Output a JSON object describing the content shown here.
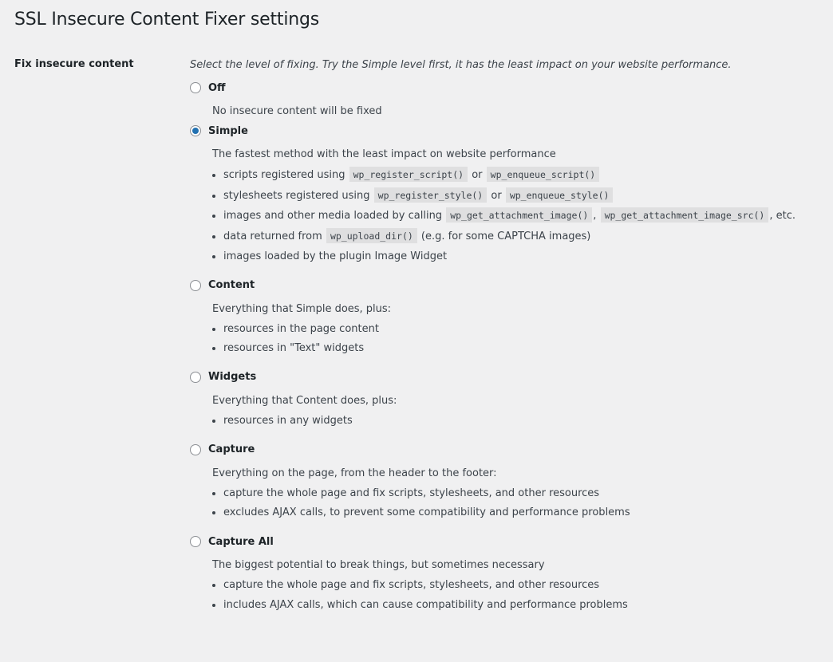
{
  "page": {
    "title": "SSL Insecure Content Fixer settings"
  },
  "setting": {
    "label": "Fix insecure content",
    "intro": "Select the level of fixing. Try the Simple level first, it has the least impact on your website performance.",
    "selected": "Simple",
    "options": [
      {
        "label": "Off",
        "checked": false,
        "description": "No insecure content will be fixed"
      },
      {
        "label": "Simple",
        "checked": true,
        "description": "The fastest method with the least impact on website performance",
        "bullets": [
          {
            "parts": [
              {
                "t": "scripts registered using "
              },
              {
                "c": "wp_register_script()"
              },
              {
                "t": " or "
              },
              {
                "c": "wp_enqueue_script()"
              }
            ]
          },
          {
            "parts": [
              {
                "t": "stylesheets registered using "
              },
              {
                "c": "wp_register_style()"
              },
              {
                "t": " or "
              },
              {
                "c": "wp_enqueue_style()"
              }
            ]
          },
          {
            "parts": [
              {
                "t": "images and other media loaded by calling "
              },
              {
                "c": "wp_get_attachment_image()"
              },
              {
                "t": ", "
              },
              {
                "c": "wp_get_attachment_image_src()"
              },
              {
                "t": ", etc."
              }
            ]
          },
          {
            "parts": [
              {
                "t": "data returned from "
              },
              {
                "c": "wp_upload_dir()"
              },
              {
                "t": " (e.g. for some CAPTCHA images)"
              }
            ]
          },
          {
            "parts": [
              {
                "t": "images loaded by the plugin Image Widget"
              }
            ]
          }
        ]
      },
      {
        "label": "Content",
        "checked": false,
        "description": "Everything that Simple does, plus:",
        "bullets": [
          {
            "parts": [
              {
                "t": "resources in the page content"
              }
            ]
          },
          {
            "parts": [
              {
                "t": "resources in \"Text\" widgets"
              }
            ]
          }
        ]
      },
      {
        "label": "Widgets",
        "checked": false,
        "description": "Everything that Content does, plus:",
        "bullets": [
          {
            "parts": [
              {
                "t": "resources in any widgets"
              }
            ]
          }
        ]
      },
      {
        "label": "Capture",
        "checked": false,
        "description": "Everything on the page, from the header to the footer:",
        "bullets": [
          {
            "parts": [
              {
                "t": "capture the whole page and fix scripts, stylesheets, and other resources"
              }
            ]
          },
          {
            "parts": [
              {
                "t": "excludes AJAX calls, to prevent some compatibility and performance problems"
              }
            ]
          }
        ]
      },
      {
        "label": "Capture All",
        "checked": false,
        "description": "The biggest potential to break things, but sometimes necessary",
        "bullets": [
          {
            "parts": [
              {
                "t": "capture the whole page and fix scripts, stylesheets, and other resources"
              }
            ]
          },
          {
            "parts": [
              {
                "t": "includes AJAX calls, which can cause compatibility and performance problems"
              }
            ]
          }
        ]
      }
    ]
  },
  "colors": {
    "accent": "#2271b1",
    "background": "#f0f0f1",
    "text": "#3c434a"
  }
}
